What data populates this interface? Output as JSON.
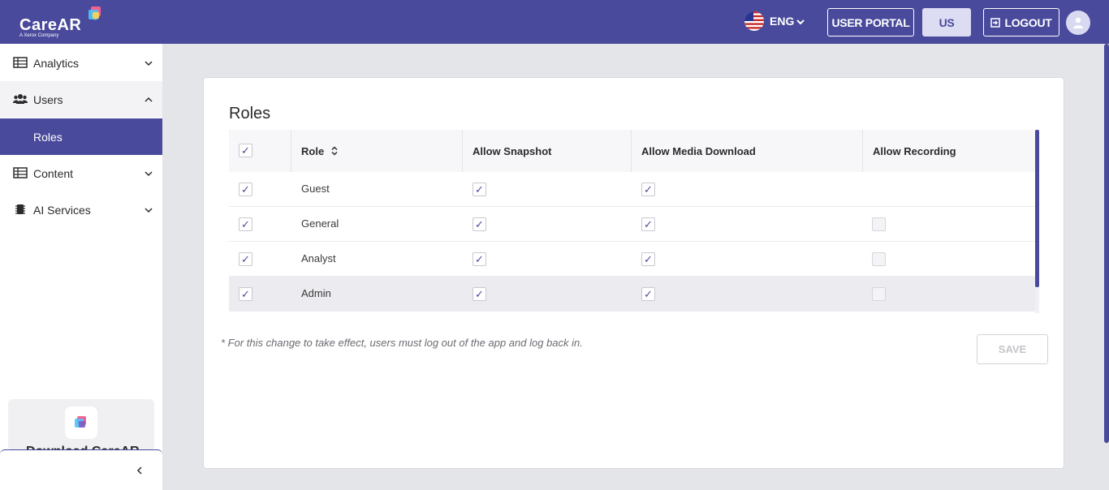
{
  "brand": {
    "logo_text": "CareAR",
    "logo_tm": "™",
    "logo_sub": "A Xerox Company",
    "accent": "#4a4a9c"
  },
  "header": {
    "language": "ENG",
    "user_portal": "USER PORTAL",
    "region": "US",
    "logout": "LOGOUT"
  },
  "sidebar": {
    "items": [
      {
        "label": "Analytics",
        "icon": "table-icon"
      },
      {
        "label": "Users",
        "icon": "users-icon"
      },
      {
        "label": "Roles",
        "icon": ""
      },
      {
        "label": "Content",
        "icon": "table-icon"
      },
      {
        "label": "AI Services",
        "icon": "chip-icon"
      }
    ],
    "download_text": "Download CareAR"
  },
  "main": {
    "title": "Roles",
    "columns": [
      "Role",
      "Allow Snapshot",
      "Allow Media Download",
      "Allow Recording"
    ],
    "rows": [
      {
        "role": "Guest"
      },
      {
        "role": "General"
      },
      {
        "role": "Analyst"
      },
      {
        "role": "Admin"
      }
    ],
    "note": "* For this change to take effect, users must log out of the app and log back in.",
    "save": "SAVE"
  }
}
